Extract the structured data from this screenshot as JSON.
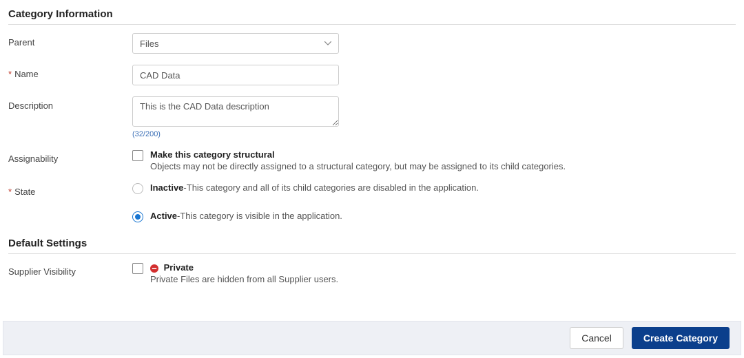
{
  "sections": {
    "category_info_title": "Category Information",
    "default_settings_title": "Default Settings"
  },
  "labels": {
    "parent": "Parent",
    "name": "Name",
    "description": "Description",
    "assignability": "Assignability",
    "state": "State",
    "supplier_visibility": "Supplier Visibility"
  },
  "fields": {
    "parent_value": "Files",
    "name_value": "CAD Data",
    "description_value": "This is the CAD Data description",
    "description_counter": "(32/200)"
  },
  "assignability": {
    "option_label": "Make this category structural",
    "option_desc": "Objects may not be directly assigned to a structural category, but may be assigned to its child categories."
  },
  "state": {
    "inactive_label": "Inactive",
    "inactive_desc": "-This category and all of its child categories are disabled in the application.",
    "active_label": "Active",
    "active_desc": "-This category is visible in the application."
  },
  "supplier_visibility": {
    "private_label": "Private",
    "private_desc": "Private Files are hidden from all Supplier users."
  },
  "footer": {
    "cancel": "Cancel",
    "create": "Create Category"
  }
}
